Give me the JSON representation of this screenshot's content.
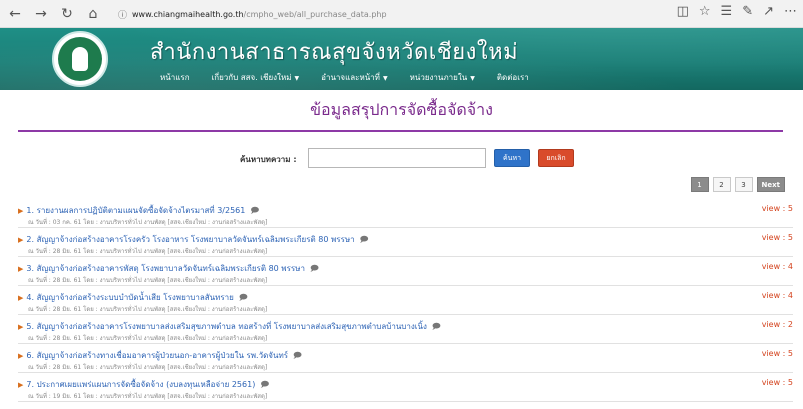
{
  "browser": {
    "url_domain": "www.chiangmaihealth.go.th",
    "url_path": "/cmpho_web/all_purchase_data.php"
  },
  "header": {
    "site_title": "สำนักงานสาธารณสุขจังหวัดเชียงใหม่",
    "nav": [
      {
        "label": "หน้าแรก",
        "has_dropdown": false
      },
      {
        "label": "เกี่ยวกับ สสจ. เชียงใหม่",
        "has_dropdown": true
      },
      {
        "label": "อำนาจและหน้าที่",
        "has_dropdown": true
      },
      {
        "label": "หน่วยงานภายใน",
        "has_dropdown": true
      },
      {
        "label": "ติดต่อเรา",
        "has_dropdown": false
      }
    ]
  },
  "page": {
    "heading": "ข้อมูลสรุปการจัดซื้อจัดจ้าง"
  },
  "search": {
    "label": "ค้นหาบทความ :",
    "value": "",
    "placeholder": "",
    "search_button": "ค้นหา",
    "cancel_button": "ยกเลิก"
  },
  "pagination": {
    "pages": [
      "1",
      "2",
      "3"
    ],
    "current": "1",
    "next_label": "Next"
  },
  "items": [
    {
      "title": "1. รายงานผลการปฏิบัติตามแผนจัดซื้อจัดจ้างไตรมาสที่ 3/2561",
      "meta": "ณ วันที่ : 03 กค. 61   โดย : งานบริหารทั่วไป งานพัสดุ [สสจ.เชียงใหม่ : งานก่อสร้างและพัสดุ]",
      "views": "view : 5"
    },
    {
      "title": "2. สัญญาจ้างก่อสร้างอาคารโรงครัว โรงอาหาร โรงพยาบาลวัดจันทร์เฉลิมพระเกียรติ 80 พรรษา",
      "meta": "ณ วันที่ : 28 มิย. 61   โดย : งานบริหารทั่วไป งานพัสดุ [สสจ.เชียงใหม่ : งานก่อสร้างและพัสดุ]",
      "views": "view : 5"
    },
    {
      "title": "3. สัญญาจ้างก่อสร้างอาคารพัสดุ โรงพยาบาลวัดจันทร์เฉลิมพระเกียรติ 80 พรรษา",
      "meta": "ณ วันที่ : 28 มิย. 61   โดย : งานบริหารทั่วไป งานพัสดุ [สสจ.เชียงใหม่ : งานก่อสร้างและพัสดุ]",
      "views": "view : 4"
    },
    {
      "title": "4. สัญญาจ้างก่อสร้างระบบบำบัดน้ำเสีย โรงพยาบาลสันทราย",
      "meta": "ณ วันที่ : 28 มิย. 61   โดย : งานบริหารทั่วไป งานพัสดุ [สสจ.เชียงใหม่ : งานก่อสร้างและพัสดุ]",
      "views": "view : 4"
    },
    {
      "title": "5. สัญญาจ้างก่อสร้างอาคารโรงพยาบาลส่งเสริมสุขภาพตำบล ทอสร้างที่ โรงพยาบาลส่งเสริมสุขภาพตำบลบ้านบางเนิ้ง",
      "meta": "ณ วันที่ : 28 มิย. 61   โดย : งานบริหารทั่วไป งานพัสดุ [สสจ.เชียงใหม่ : งานก่อสร้างและพัสดุ]",
      "views": "view : 2"
    },
    {
      "title": "6. สัญญาจ้างก่อสร้างทางเชื่อมอาคารผู้ป่วยนอก-อาคารผู้ป่วยใน รพ.วัดจันทร์",
      "meta": "ณ วันที่ : 28 มิย. 61   โดย : งานบริหารทั่วไป งานพัสดุ [สสจ.เชียงใหม่ : งานก่อสร้างและพัสดุ]",
      "views": "view : 5"
    },
    {
      "title": "7. ประกาศเผยแพร่แผนการจัดซื้อจัดจ้าง (งบลงทุนเหลือจ่าย 2561)",
      "meta": "ณ วันที่ : 19 มิย. 61   โดย : งานบริหารทั่วไป งานพัสดุ [สสจ.เชียงใหม่ : งานก่อสร้างและพัสดุ]",
      "views": "view : 5"
    }
  ]
}
